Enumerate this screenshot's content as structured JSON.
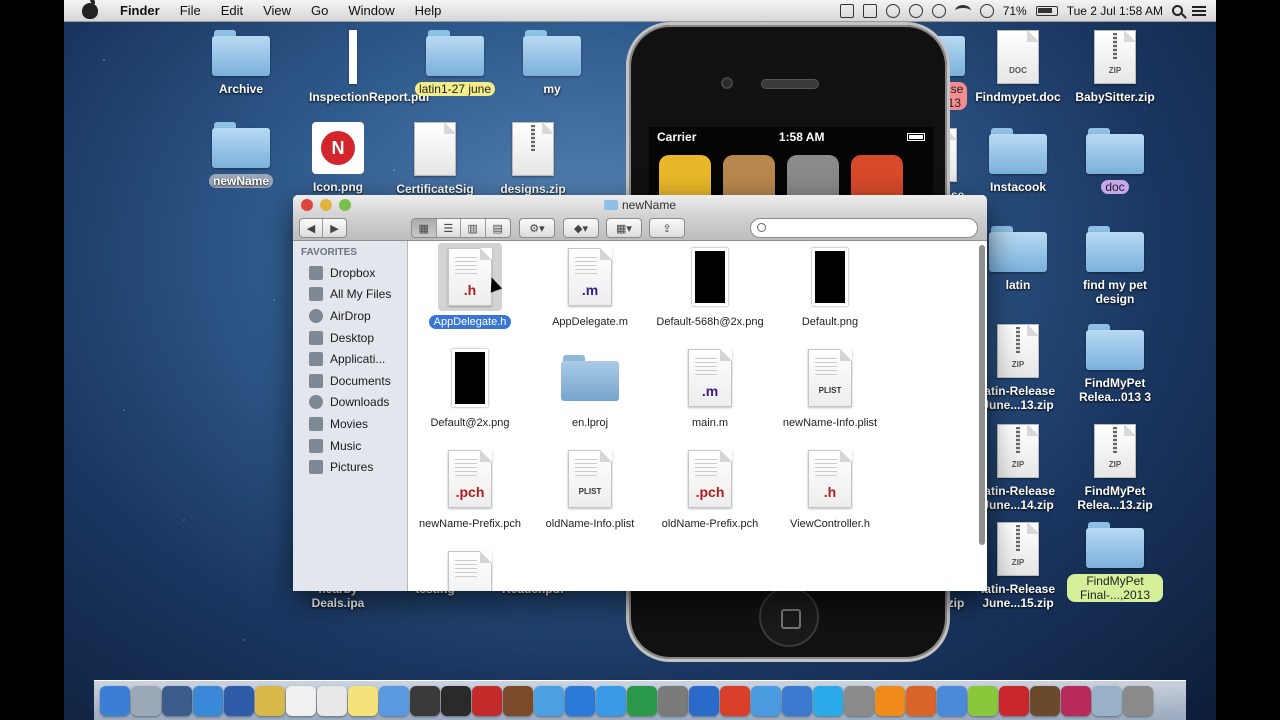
{
  "menubar": {
    "app": "Finder",
    "items": [
      "File",
      "Edit",
      "View",
      "Go",
      "Window",
      "Help"
    ],
    "battery": "71%",
    "datetime": "Tue 2 Jul  1:58 AM"
  },
  "desktop_icons": [
    {
      "name": "Archive",
      "kind": "folder"
    },
    {
      "name": "InspectionReport.pdf",
      "kind": "pdf"
    },
    {
      "name": "latin1-27 june",
      "kind": "folder",
      "label": "yellow"
    },
    {
      "name": "my",
      "kind": "folder"
    },
    {
      "name": "newName",
      "kind": "folder",
      "label": "selected"
    },
    {
      "name": "Icon.png",
      "kind": "app"
    },
    {
      "name": "CertificateSig",
      "kind": "doc"
    },
    {
      "name": "designs.zip",
      "kind": "zip"
    },
    {
      "name": "n-Release\ne 4, 2013",
      "kind": "folder",
      "label": "red"
    },
    {
      "name": "Findmypet.doc",
      "kind": "doc",
      "tag": "DOC"
    },
    {
      "name": "BabySitter.zip",
      "kind": "zip",
      "tag": "ZIP"
    },
    {
      "name": "n-Release\n.zip",
      "kind": "zip"
    },
    {
      "name": "Instacook",
      "kind": "folder"
    },
    {
      "name": "doc",
      "kind": "folder",
      "label": "purple"
    },
    {
      "name": "ase\n13",
      "kind": "folder",
      "label": "red"
    },
    {
      "name": "latin",
      "kind": "folder"
    },
    {
      "name": "find my pet design",
      "kind": "folder"
    },
    {
      "name": "ase\n.zip",
      "kind": "zip"
    },
    {
      "name": "latin-Release June...13.zip",
      "kind": "zip",
      "tag": "ZIP"
    },
    {
      "name": "FindMyPet Relea...013 3",
      "kind": "folder"
    },
    {
      "name": "ase\n.zip",
      "kind": "zip"
    },
    {
      "name": "latin-Release June...14.zip",
      "kind": "zip",
      "tag": "ZIP"
    },
    {
      "name": "FindMyPet Relea...13.zip",
      "kind": "zip",
      "tag": "ZIP"
    },
    {
      "name": "ase\nv3...14.zip",
      "kind": "zip"
    },
    {
      "name": "latin-Release June...15.zip",
      "kind": "zip",
      "tag": "ZIP"
    },
    {
      "name": "FindMyPet Final-...,2013",
      "kind": "folder",
      "label": "green"
    },
    {
      "name": "nearby Deals.ipa",
      "kind": "doc"
    },
    {
      "name": "testing",
      "kind": "doc"
    },
    {
      "name": "Reader.pdf",
      "kind": "doc"
    }
  ],
  "simulator": {
    "carrier": "Carrier",
    "time": "1:58 AM",
    "apps": [
      {
        "name": "photos",
        "color": "#e8b82a"
      },
      {
        "name": "contacts",
        "color": "#b8874e"
      },
      {
        "name": "settings",
        "color": "#8a8a8a"
      },
      {
        "name": "game-center",
        "color": "#d84a2a"
      }
    ]
  },
  "finder": {
    "title": "newName",
    "search_placeholder": "",
    "sidebar_heading": "FAVORITES",
    "favorites": [
      "Dropbox",
      "All My Files",
      "AirDrop",
      "Desktop",
      "Applicati...",
      "Documents",
      "Downloads",
      "Movies",
      "Music",
      "Pictures"
    ],
    "files": [
      {
        "name": "AppDelegate.h",
        "type": "h",
        "ext": ".h",
        "selected": true
      },
      {
        "name": "AppDelegate.m",
        "type": "m",
        "ext": ".m"
      },
      {
        "name": "Default-568h@2x.png",
        "type": "img"
      },
      {
        "name": "Default.png",
        "type": "img"
      },
      {
        "name": "Default@2x.png",
        "type": "img"
      },
      {
        "name": "en.lproj",
        "type": "folder"
      },
      {
        "name": "main.m",
        "type": "m",
        "ext": ".m"
      },
      {
        "name": "newName-Info.plist",
        "type": "plist",
        "ext": "PLIST"
      },
      {
        "name": "newName-Prefix.pch",
        "type": "pch",
        "ext": ".pch"
      },
      {
        "name": "oldName-Info.plist",
        "type": "plist",
        "ext": "PLIST"
      },
      {
        "name": "oldName-Prefix.pch",
        "type": "pch",
        "ext": ".pch"
      },
      {
        "name": "ViewController.h",
        "type": "h",
        "ext": ".h"
      },
      {
        "name": "",
        "type": "doc",
        "ext": ""
      }
    ]
  },
  "dock": {
    "colors": [
      "#3a7fd5",
      "#9aa8b8",
      "#3b5b8a",
      "#3a88d8",
      "#2e5aa8",
      "#d8b94a",
      "#f0f0f0",
      "#e8e8e8",
      "#f4e27a",
      "#5a9ae0",
      "#3a3a3a",
      "#2a2a2a",
      "#c32a2a",
      "#7a4a2a",
      "#4aa0e0",
      "#2a7ad8",
      "#3a9ae8",
      "#2a9a4a",
      "#7a7a7a",
      "#2a6ac8",
      "#d8402a",
      "#4a9ae0",
      "#3a7ad0",
      "#2aaae8",
      "#8a8a8a",
      "#f08a1a",
      "#d8642a",
      "#4a8ad8",
      "#88c83a",
      "#c8262a",
      "#6a4a2a",
      "#b82a5a",
      "#9ab0c8",
      "#8a8a8a"
    ]
  }
}
